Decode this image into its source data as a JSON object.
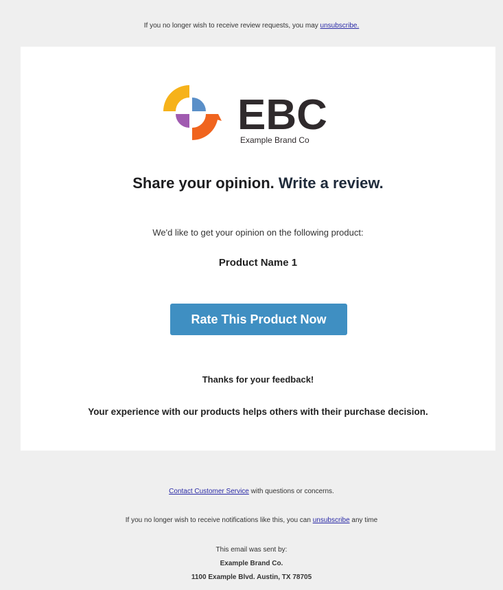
{
  "top_notice": {
    "text": "If you no longer wish to receive review requests, you may ",
    "link": "unsubscribe."
  },
  "brand": {
    "logo_letters": "EBC",
    "name": "Example Brand Co",
    "colors": {
      "yellow": "#f6b21a",
      "blue": "#5a8fc8",
      "purple": "#a05bb0",
      "orange": "#f0641e",
      "dark": "#2f2a2c"
    }
  },
  "headline": {
    "part1": "Share your opinion.",
    "part2": "Write a review."
  },
  "intro": "We'd like to get your opinion on the following product:",
  "product_name": "Product Name 1",
  "cta_label": "Rate This Product Now",
  "thanks": "Thanks for your feedback!",
  "experience": "Your experience with our products helps others with their purchase decision.",
  "footer": {
    "contact_link": "Contact Customer Service",
    "contact_text": " with questions or concerns.",
    "notify_text": "If you no longer wish to receive notifications like this, you can ",
    "notify_link": "unsubscribe",
    "notify_suffix": " any time",
    "sent_by": "This email was sent by:",
    "company": "Example Brand Co.",
    "address": "1100 Example Blvd. Austin, TX 78705"
  },
  "accent_color": "#3f8fc2"
}
